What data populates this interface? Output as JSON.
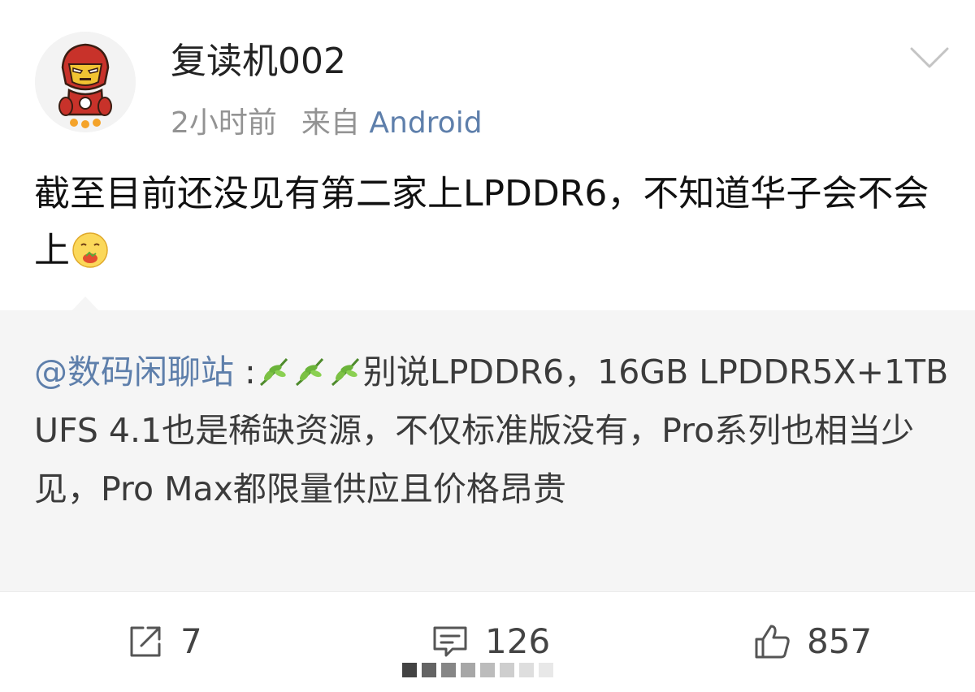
{
  "post": {
    "username": "复读机002",
    "time": "2小时前",
    "source_prefix": "来自",
    "source": "Android",
    "text": "截至目前还没见有第二家上LPDDR6，不知道华子会不会上"
  },
  "repost": {
    "mention": "@数码闲聊站",
    "colon": " :",
    "text": "别说LPDDR6，16GB LPDDR5X+1TB UFS 4.1也是稀缺资源，不仅标准版没有，Pro系列也相当少见，Pro Max都限量供应且价格昂贵"
  },
  "actions": {
    "share_count": "7",
    "comment_count": "126",
    "like_count": "857"
  },
  "icons": {
    "avatar": "iron-man-avatar",
    "menu": "chevron-down-icon",
    "share": "share-icon",
    "comment": "comment-icon",
    "like": "thumbs-up-icon"
  },
  "colors": {
    "link": "#5e7fab",
    "meta": "#939393",
    "repost_bg": "#f5f5f5"
  }
}
